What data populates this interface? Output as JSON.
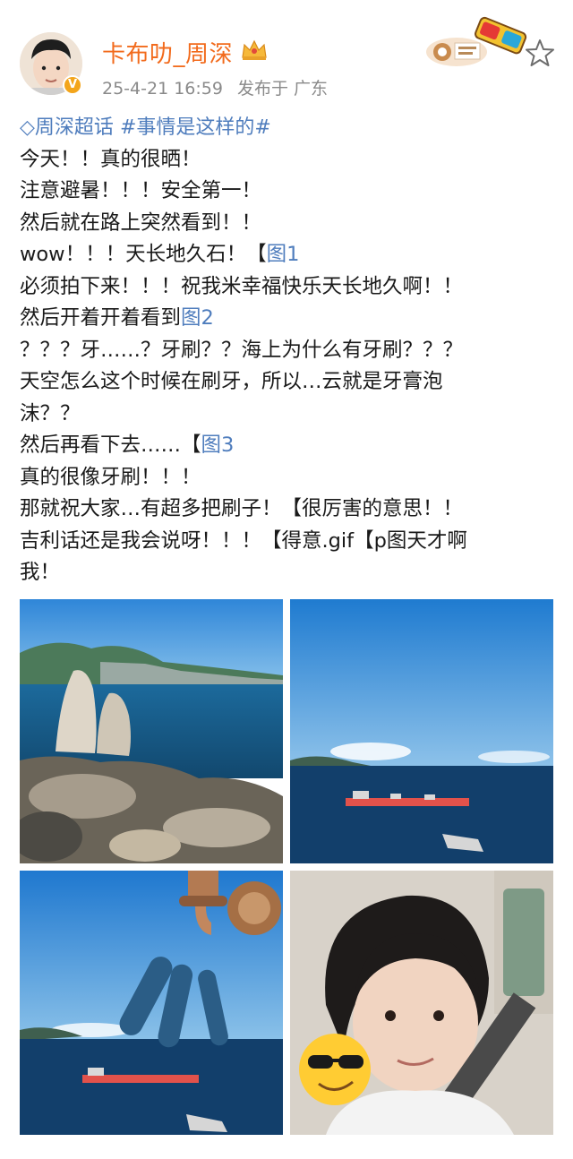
{
  "post": {
    "username": "卡布叻_周深",
    "timestamp": "25-4-21 16:59",
    "location": "发布于 广东",
    "topics": {
      "supertopic": "周深超话",
      "hashtag": "#事情是这样的#"
    },
    "body": [
      {
        "text": "今天！！真的很晒！"
      },
      {
        "text": "注意避暑！！！安全第一！"
      },
      {
        "text": "然后就在路上突然看到！！"
      },
      {
        "text": "wow！！！天长地久石！【",
        "link": "图1"
      },
      {
        "text": "必须拍下来！！！祝我米幸福快乐天长地久啊！！"
      },
      {
        "text": "然后开着开着看到",
        "link": "图2"
      },
      {
        "text": "？？？牙……？牙刷？？海上为什么有牙刷？？？"
      },
      {
        "text": "天空怎么这个时候在刷牙，所以…云就是牙膏泡"
      },
      {
        "text": "沫？？"
      },
      {
        "text": "然后再看下去……【",
        "link": "图3"
      },
      {
        "text": "真的很像牙刷！！！"
      },
      {
        "text": "那就祝大家…有超多把刷子！【很厉害的意思！！"
      },
      {
        "text": "吉利话还是我会说呀！！！【得意.gif【p图天才啊"
      },
      {
        "text": "我！"
      }
    ]
  },
  "icons": {
    "verified": "verified-badge-icon",
    "crown": "crown-icon",
    "star": "star-outline-icon",
    "supertopic": "diamond-icon",
    "badge": "3d-glasses-badge-icon"
  },
  "colors": {
    "username": "#f26b1d",
    "link": "#4f7dbd",
    "meta": "#8a8a8a"
  }
}
